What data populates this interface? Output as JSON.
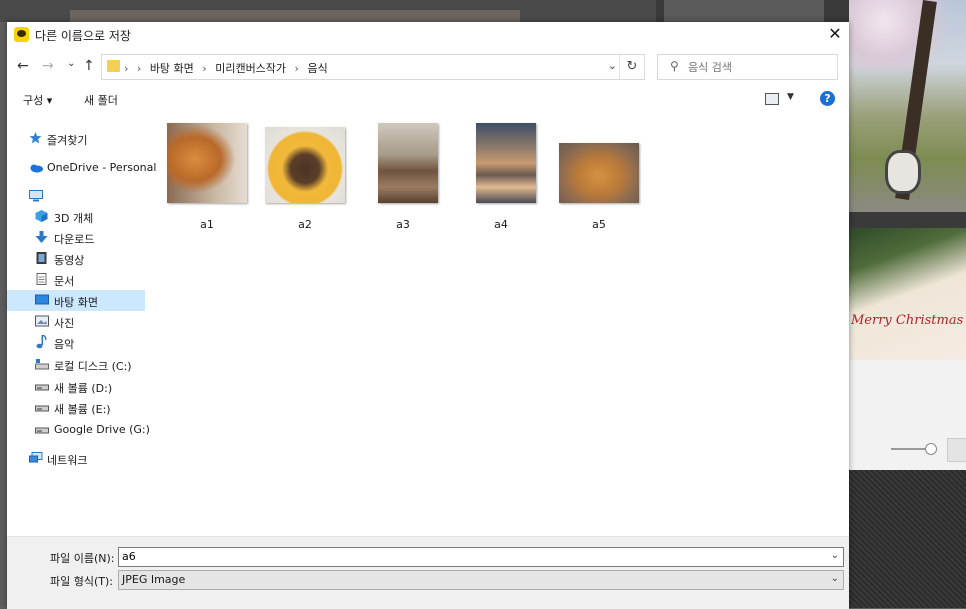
{
  "dialog": {
    "title": "다른 이름으로 저장",
    "close_glyph": "✕"
  },
  "nav": {
    "back_glyph": "←",
    "forward_glyph": "→",
    "recent_glyph": "⌄",
    "up_glyph": "↑",
    "breadcrumb_root_sep": "›",
    "breadcrumbs": [
      "바탕 화면",
      "미리캔버스작가",
      "음식"
    ],
    "breadcrumb_sep": "›",
    "dropdown_glyph": "⌄",
    "refresh_glyph": "↻"
  },
  "search": {
    "icon_glyph": "⚲",
    "placeholder": "음식 검색"
  },
  "toolbar": {
    "organize_label": "구성 ▾",
    "new_folder_label": "새 폴더",
    "view_dropdown_glyph": "▼",
    "help_glyph": "?"
  },
  "sidebar": {
    "items": [
      {
        "label": "즐겨찾기",
        "icon": "star-icon"
      },
      {
        "label": "OneDrive - Personal",
        "icon": "cloud-icon"
      },
      {
        "label": "",
        "icon": "computer-icon"
      },
      {
        "label": "3D 개체",
        "icon": "cube-icon"
      },
      {
        "label": "다운로드",
        "icon": "download-icon"
      },
      {
        "label": "동영상",
        "icon": "video-icon"
      },
      {
        "label": "문서",
        "icon": "document-icon"
      },
      {
        "label": "바탕 화면",
        "icon": "desktop-icon"
      },
      {
        "label": "사진",
        "icon": "picture-icon"
      },
      {
        "label": "음악",
        "icon": "music-icon"
      },
      {
        "label": "로컬 디스크 (C:)",
        "icon": "local-disk-icon"
      },
      {
        "label": "새 볼륨 (D:)",
        "icon": "drive-icon"
      },
      {
        "label": "새 볼륨 (E:)",
        "icon": "drive-icon"
      },
      {
        "label": "Google Drive (G:)",
        "icon": "drive-icon"
      },
      {
        "label": "네트워크",
        "icon": "network-icon"
      }
    ]
  },
  "files": [
    {
      "name": "a1"
    },
    {
      "name": "a2"
    },
    {
      "name": "a3"
    },
    {
      "name": "a4"
    },
    {
      "name": "a5"
    }
  ],
  "bottom": {
    "filename_label": "파일 이름(N):",
    "filename_value": "a6",
    "filetype_label": "파일 형식(T):",
    "filetype_value": "JPEG Image",
    "chevron_glyph": "⌄"
  },
  "background": {
    "cake_text": "Merry Christmas"
  },
  "colors": {
    "selection": "#cce8ff",
    "accent": "#1a6fd1",
    "folder": "#f5cf55"
  }
}
